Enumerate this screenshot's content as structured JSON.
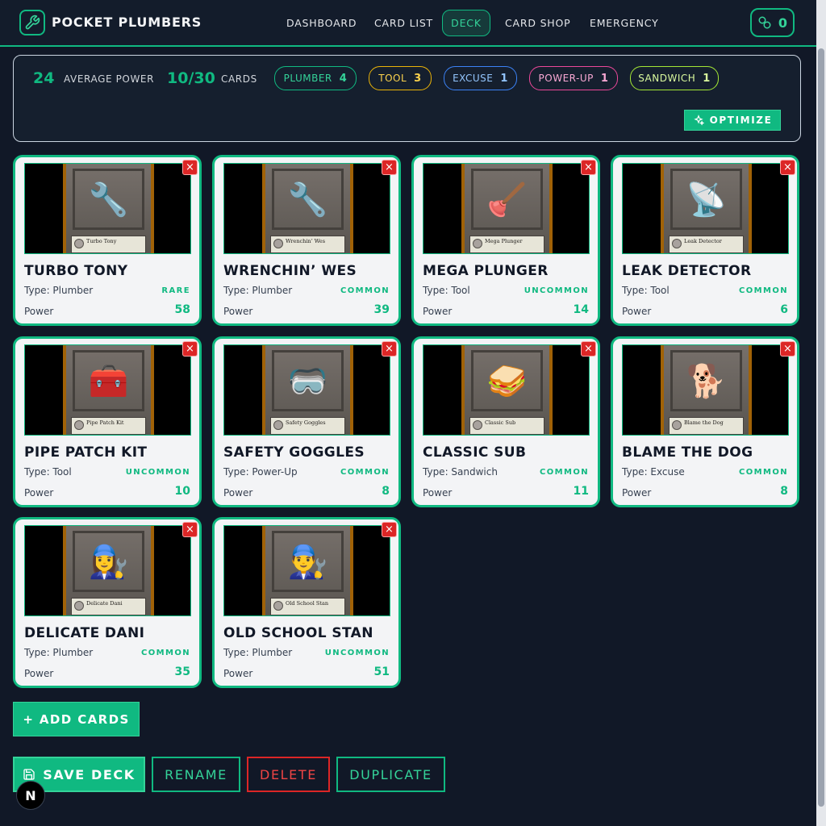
{
  "app": {
    "title": "POCKET PLUMBERS",
    "coins": "0"
  },
  "nav": {
    "items": [
      "DASHBOARD",
      "CARD LIST",
      "DECK",
      "CARD SHOP",
      "EMERGENCY"
    ],
    "active": "DECK"
  },
  "stats": {
    "avg_power": "24",
    "avg_power_label": "AVERAGE POWER",
    "card_count": "10/30",
    "card_count_label": "CARDS",
    "types": [
      {
        "label": "PLUMBER",
        "count": "4"
      },
      {
        "label": "TOOL",
        "count": "3"
      },
      {
        "label": "EXCUSE",
        "count": "1"
      },
      {
        "label": "POWER-UP",
        "count": "1"
      },
      {
        "label": "SANDWICH",
        "count": "1"
      }
    ],
    "optimize_label": "OPTIMIZE"
  },
  "cards": [
    {
      "name": "TURBO TONY",
      "type": "Type: Plumber",
      "rarity": "RARE",
      "power_label": "Power",
      "power": "58",
      "caption": "Turbo Tony",
      "art": "🔧"
    },
    {
      "name": "WRENCHIN’ WES",
      "type": "Type: Plumber",
      "rarity": "COMMON",
      "power_label": "Power",
      "power": "39",
      "caption": "Wrenchin’ Wes",
      "art": "🔧"
    },
    {
      "name": "MEGA PLUNGER",
      "type": "Type: Tool",
      "rarity": "UNCOMMON",
      "power_label": "Power",
      "power": "14",
      "caption": "Mega Plunger",
      "art": "🪠"
    },
    {
      "name": "LEAK DETECTOR",
      "type": "Type: Tool",
      "rarity": "COMMON",
      "power_label": "Power",
      "power": "6",
      "caption": "Leak Detector",
      "art": "📡"
    },
    {
      "name": "PIPE PATCH KIT",
      "type": "Type: Tool",
      "rarity": "UNCOMMON",
      "power_label": "Power",
      "power": "10",
      "caption": "Pipe Patch Kit",
      "art": "🧰"
    },
    {
      "name": "SAFETY GOGGLES",
      "type": "Type: Power-Up",
      "rarity": "COMMON",
      "power_label": "Power",
      "power": "8",
      "caption": "Safety Goggles",
      "art": "🥽"
    },
    {
      "name": "CLASSIC SUB",
      "type": "Type: Sandwich",
      "rarity": "COMMON",
      "power_label": "Power",
      "power": "11",
      "caption": "Classic Sub",
      "art": "🥪"
    },
    {
      "name": "BLAME THE DOG",
      "type": "Type: Excuse",
      "rarity": "COMMON",
      "power_label": "Power",
      "power": "8",
      "caption": "Blame the Dog",
      "art": "🐕"
    },
    {
      "name": "DELICATE DANI",
      "type": "Type: Plumber",
      "rarity": "COMMON",
      "power_label": "Power",
      "power": "35",
      "caption": "Delicate Dani",
      "art": "👩‍🔧"
    },
    {
      "name": "OLD SCHOOL STAN",
      "type": "Type: Plumber",
      "rarity": "UNCOMMON",
      "power_label": "Power",
      "power": "51",
      "caption": "Old School Stan",
      "art": "👨‍🔧"
    }
  ],
  "actions": {
    "add_cards": "+ ADD CARDS",
    "save": "SAVE DECK",
    "rename": "RENAME",
    "delete": "DELETE",
    "duplicate": "DUPLICATE"
  },
  "badge": "N",
  "colors": {
    "accent": "#10b981",
    "danger": "#dc2626",
    "background": "#111827"
  }
}
